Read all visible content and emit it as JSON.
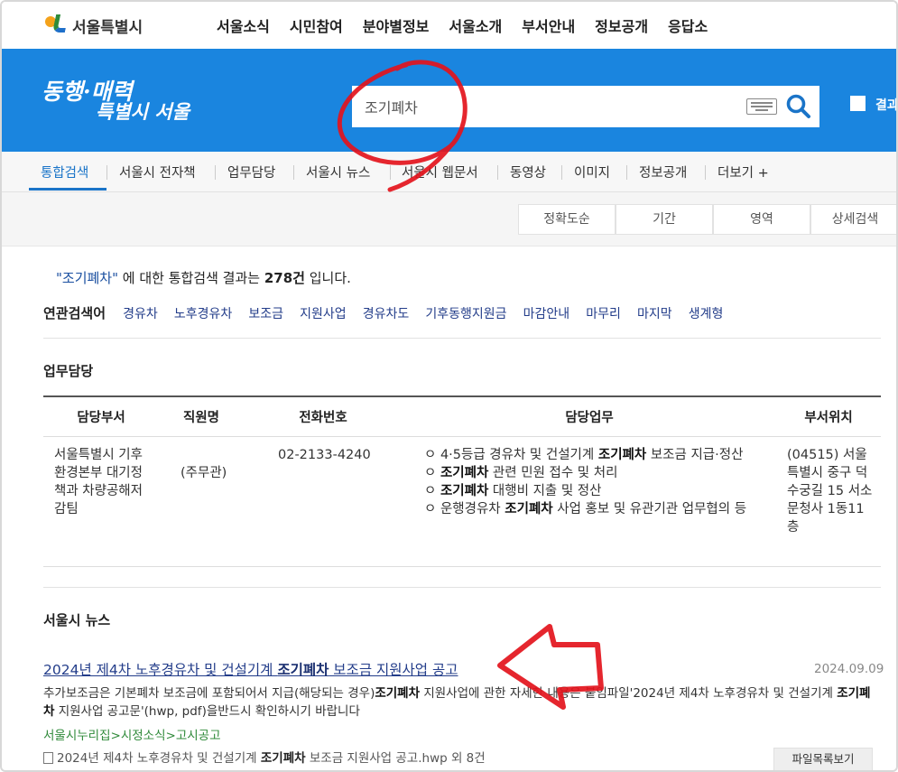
{
  "header": {
    "logo_text": "서울특별시",
    "nav": [
      "서울소식",
      "시민참여",
      "분야별정보",
      "서울소개",
      "부서안내",
      "정보공개",
      "응답소"
    ]
  },
  "band": {
    "slogan_line1": "동행·매력",
    "slogan_line2": "특별시 서울",
    "search_value": "조기폐차",
    "result_label": "결과"
  },
  "tabs": [
    "통합검색",
    "서울시 전자책",
    "업무담당",
    "서울시 뉴스",
    "서울시 웹문서",
    "동영상",
    "이미지",
    "정보공개",
    "더보기 +"
  ],
  "filters": [
    "정확도순",
    "기간",
    "영역",
    "상세검색"
  ],
  "summary": {
    "query": "\"조기폐차\"",
    "mid": " 에 대한 통합검색 결과는 ",
    "count": "278건",
    "end": " 입니다."
  },
  "related": {
    "label": "연관검색어",
    "keywords": [
      "경유차",
      "노후경유차",
      "보조금",
      "지원사업",
      "경유차도",
      "기후동행지원금",
      "마감안내",
      "마무리",
      "마지막",
      "생계형"
    ]
  },
  "staff": {
    "title": "업무담당",
    "headers": [
      "담당부서",
      "직원명",
      "전화번호",
      "담당업무",
      "부서위치"
    ],
    "row": {
      "dept": "서울특별시 기후환경본부 대기정책과 차량공해저감팀",
      "name": "(주무관)",
      "phone": "02-2133-4240",
      "duties": [
        {
          "pre": "ㅇ 4·5등급 경유차 및 건설기계 ",
          "kw": "조기폐차",
          "post": " 보조금 지급·정산"
        },
        {
          "pre": "ㅇ ",
          "kw": "조기폐차",
          "post": " 관련 민원 접수 및 처리"
        },
        {
          "pre": "ㅇ ",
          "kw": "조기폐차",
          "post": " 대행비 지출 및 정산"
        },
        {
          "pre": "ㅇ 운행경유차 ",
          "kw": "조기폐차",
          "post": " 사업 홍보 및 유관기관 업무협의 등"
        }
      ],
      "location": "(04515) 서울특별시 중구 덕수궁길 15 서소문청사 1동11층"
    }
  },
  "news": {
    "title": "서울시 뉴스",
    "link_pre": "2024년 제4차 노후경유차 및 건설기계 ",
    "link_kw": "조기폐차",
    "link_post": " 보조금 지원사업 공고",
    "date": "2024.09.09",
    "desc_pre": "추가보조금은 기본폐차 보조금에 포함되어서 지급(해당되는 경우)",
    "desc_kw1": "조기폐차",
    "desc_mid": " 지원사업에 관한 자세한 내용은 붙임파일'2024년 제4차 노후경유차 및 건설기계 ",
    "desc_kw2": "조기폐차",
    "desc_post": " 지원사업 공고문'(hwp, pdf)을반드시 확인하시기 바랍니다",
    "path": "서울시누리집>시정소식>고시공고",
    "file_pre": "2024년 제4차 노후경유차 및 건설기계 ",
    "file_kw": "조기폐차",
    "file_post": " 보조금 지원사업 공고.hwp 외 8건",
    "file_button": "파일목록보기"
  },
  "colors": {
    "brand_blue": "#1a85df",
    "link": "#233d8a",
    "annotation_red": "#e3141c"
  },
  "icons": [
    "seoul-logo-icon",
    "keyboard-icon",
    "search-icon",
    "file-icon"
  ]
}
